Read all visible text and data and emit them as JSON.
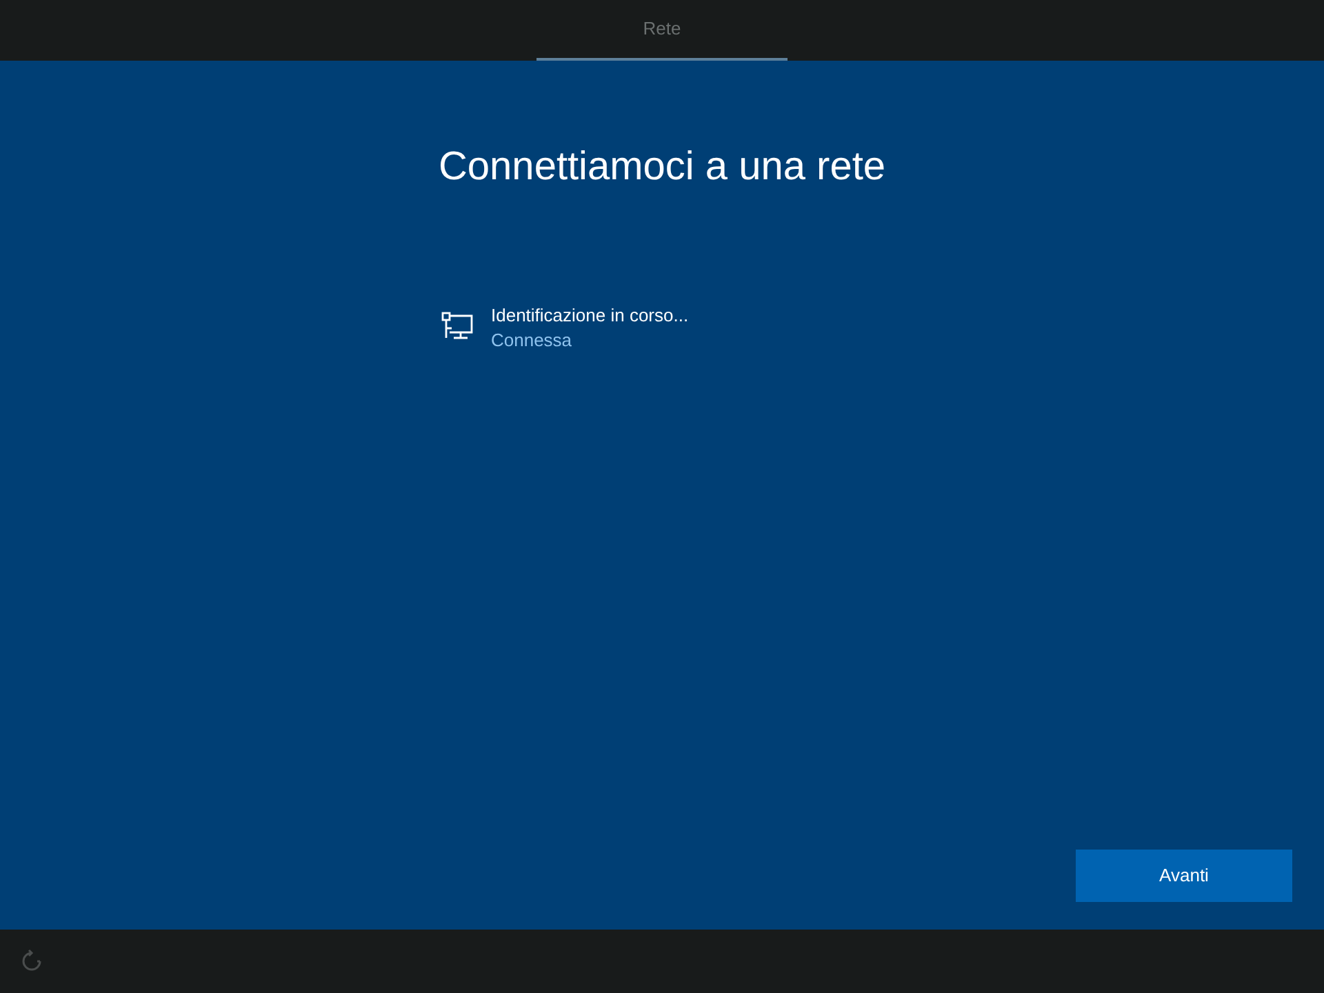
{
  "tabs": [
    {
      "label": "Rete",
      "selected": true
    }
  ],
  "title": "Connettiamoci a una rete",
  "networks": [
    {
      "name": "Identificazione in corso...",
      "status": "Connessa"
    }
  ],
  "buttons": [
    {
      "label": "Avanti"
    }
  ]
}
